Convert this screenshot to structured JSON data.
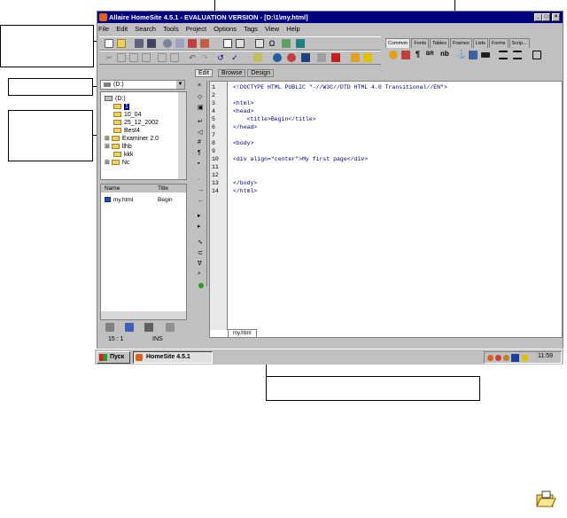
{
  "window": {
    "title": "Allaire HomeSite 4.5.1 - EVALUATION VERSION - [D:\\1\\my.html]",
    "controls": [
      "_",
      "□",
      "×"
    ]
  },
  "menubar": [
    "File",
    "Edit",
    "Search",
    "Tools",
    "Project",
    "Options",
    "Tags",
    "View",
    "Help"
  ],
  "tag_tabs": [
    "Common",
    "Fonts",
    "Tables",
    "Frames",
    "Lists",
    "Forms",
    "Scrip..."
  ],
  "tag_buttons": [
    "¶",
    "BR",
    "nb"
  ],
  "left_panel": {
    "drive": "(D:)",
    "tree": [
      "(D:)",
      "1",
      "10_04",
      "25_12_2002",
      "Best4",
      "Examiner 2.0",
      "llhb",
      "kkk",
      "Nc"
    ],
    "file_headers": [
      "Name",
      "Title"
    ],
    "files": [
      {
        "name": "my.html",
        "title": "Begin"
      }
    ]
  },
  "editor": {
    "tabs": [
      "Edit",
      "Browse",
      "Design"
    ],
    "lines": [
      "<!DOCTYPE HTML PUBLIC \"-//W3C//DTD HTML 4.0 Transitional//EN\">",
      "",
      "<html>",
      "<head>",
      "    <title>Begin</title>",
      "</head>",
      "",
      "<body>",
      "",
      "<div align=\"center\">My first page</div>",
      "",
      "",
      "</body>",
      "</html>"
    ],
    "doc_tab": "my.html"
  },
  "status": {
    "position": "15 : 1",
    "mode": "INS"
  },
  "taskbar": {
    "start": "Пуск",
    "task": "HomeSite 4.5.1",
    "clock": "11:59"
  }
}
